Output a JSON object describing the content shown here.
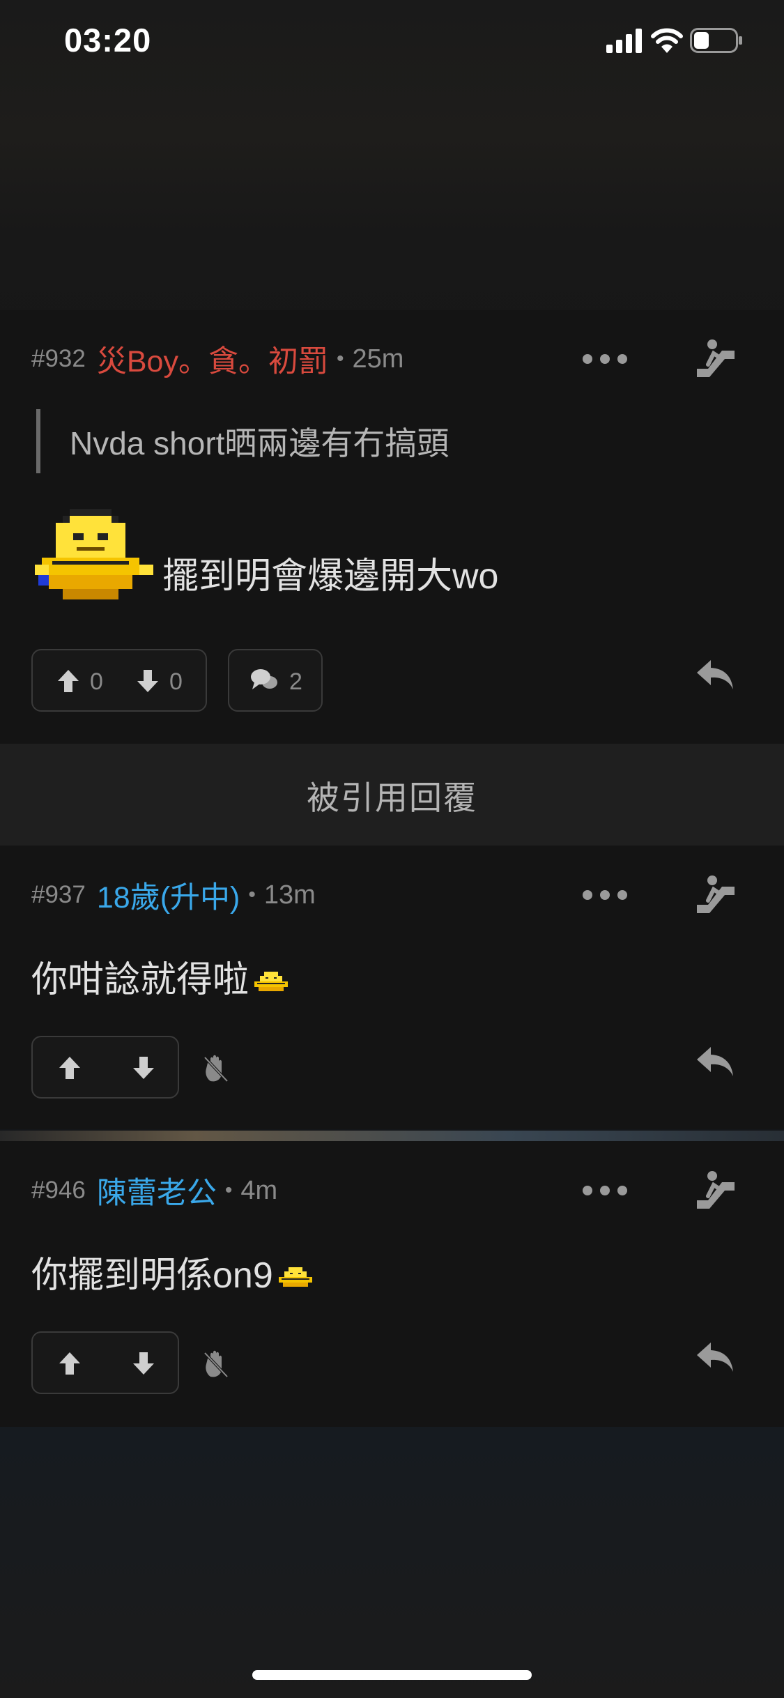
{
  "status_bar": {
    "time": "03:20"
  },
  "posts": [
    {
      "floor": "#932",
      "username": "災Boy。貪。初罰",
      "separator": "•",
      "ago": "25m",
      "quote": "Nvda short晒兩邊有冇搞頭",
      "content": "擺到明會爆邊開大wo",
      "upvotes": "0",
      "downvotes": "0",
      "comments": "2"
    },
    {
      "floor": "#937",
      "username": "18歲(升中)",
      "separator": "•",
      "ago": "13m",
      "content": "你咁諗就得啦"
    },
    {
      "floor": "#946",
      "username": "陳蕾老公",
      "separator": "•",
      "ago": "4m",
      "content": "你擺到明係on9"
    }
  ],
  "quoted_replies_header": "被引用回覆",
  "colors": {
    "username_red": "#d94a3e",
    "username_blue": "#3aa8ea",
    "background": "#141414"
  }
}
